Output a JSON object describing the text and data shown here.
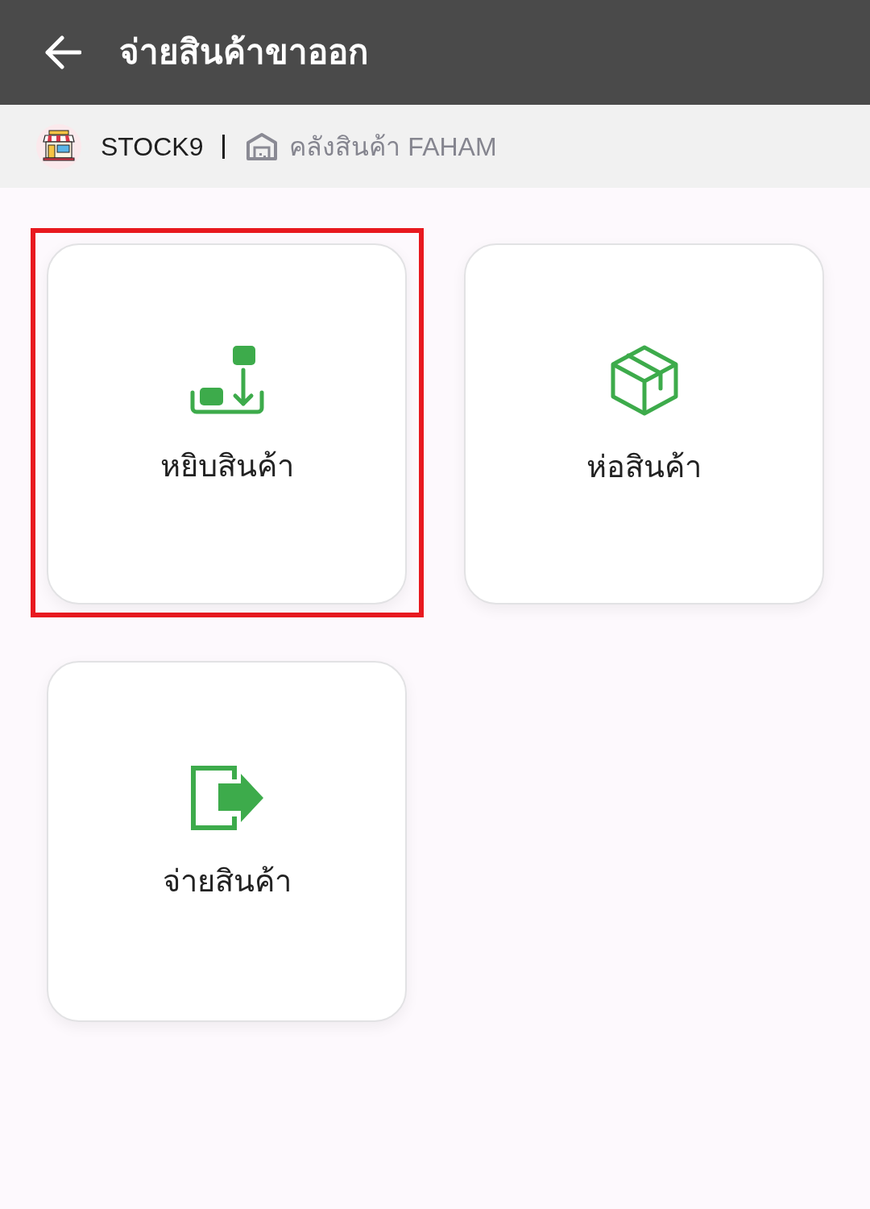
{
  "header": {
    "title": "จ่ายสินค้าขาออก"
  },
  "store_bar": {
    "store_name": "STOCK9",
    "warehouse": "คลังสินค้า FAHAM"
  },
  "tiles": [
    {
      "label": "หยิบสินค้า",
      "highlighted": true
    },
    {
      "label": "ห่อสินค้า",
      "highlighted": false
    },
    {
      "label": "จ่ายสินค้า",
      "highlighted": false
    }
  ]
}
